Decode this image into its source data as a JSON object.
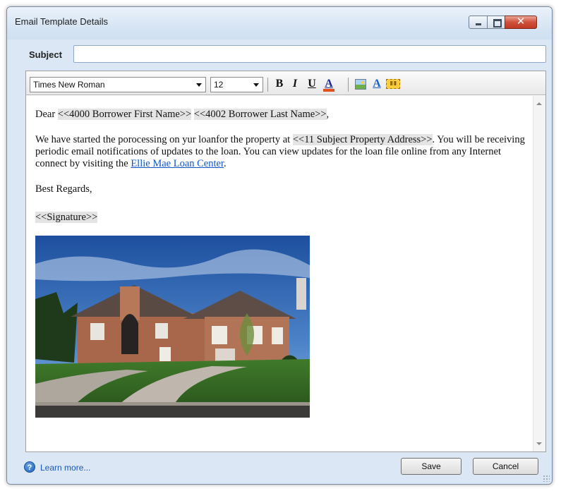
{
  "window": {
    "title": "Email Template Details",
    "controls": [
      "minimize-icon",
      "maximize-icon",
      "close-icon"
    ]
  },
  "subject": {
    "label": "Subject",
    "value": ""
  },
  "toolbar": {
    "font_family": "Times New Roman",
    "font_size": "12",
    "bold": "B",
    "italic": "I",
    "underline": "U",
    "font_color": "A",
    "background_color": "A",
    "insert_image_icon": "image-icon",
    "insert_field_icon": "field-icon",
    "insert_field_glyph": "II II",
    "accent_font_color": "#e2511c"
  },
  "body": {
    "greeting_prefix": "Dear",
    "field_first_name": "<<4000 Borrower First Name>>",
    "field_last_name": "<<4002 Borrower Last Name>>",
    "greeting_suffix": ",",
    "para_text_1": "We have started the porocessing on yur loanfor the property at",
    "field_address": "<<11 Subject Property Address>>",
    "para_text_2": ". You will be receiving periodic email notifications of updates to the loan. You can view updates for the loan file online from any Internet connect by visiting the",
    "link_text": "Ellie Mae Loan Center",
    "para_text_3": ".",
    "closing": "Best Regards,",
    "signature_field": "<<Signature>>",
    "image_subject": "house-photo"
  },
  "footer": {
    "learn_more": "Learn more...",
    "save": "Save",
    "cancel": "Cancel"
  },
  "colors": {
    "link": "#1155cc",
    "field_highlight": "#e4e4e4",
    "window_chrome": "#dbe7f4"
  }
}
